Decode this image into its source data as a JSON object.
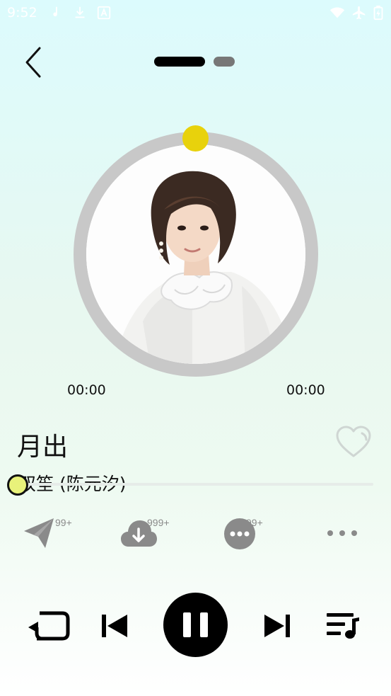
{
  "status_bar": {
    "time": "9:52",
    "icons": [
      "music-note-icon",
      "download-icon",
      "font-a-icon",
      "wifi-icon",
      "airplane-icon",
      "battery-charging-icon"
    ]
  },
  "header": {
    "back_icon": "chevron-left-icon",
    "pages": {
      "count": 2,
      "active": 1
    }
  },
  "player": {
    "current_time": "00:00",
    "total_time": "00:00",
    "progress": 0,
    "song_title": "月出",
    "artist": "双笙 (陈元汐)",
    "liked": false
  },
  "actions": [
    {
      "name": "share",
      "icon": "paper-plane-icon",
      "badge": "99+"
    },
    {
      "name": "download",
      "icon": "cloud-download-icon",
      "badge": "999+"
    },
    {
      "name": "comments",
      "icon": "comment-dots-icon",
      "badge": "99+"
    },
    {
      "name": "more",
      "icon": "more-horizontal-icon",
      "badge": ""
    }
  ],
  "controls": {
    "repeat_icon": "repeat-icon",
    "prev_icon": "skip-previous-icon",
    "pause_icon": "pause-icon",
    "next_icon": "skip-next-icon",
    "playlist_icon": "playlist-icon"
  },
  "colors": {
    "accent_knob": "#e8d20c",
    "seek_knob": "#e8f27a",
    "ring": "#c8c8c8",
    "icon_gray": "#8a8a8a"
  }
}
